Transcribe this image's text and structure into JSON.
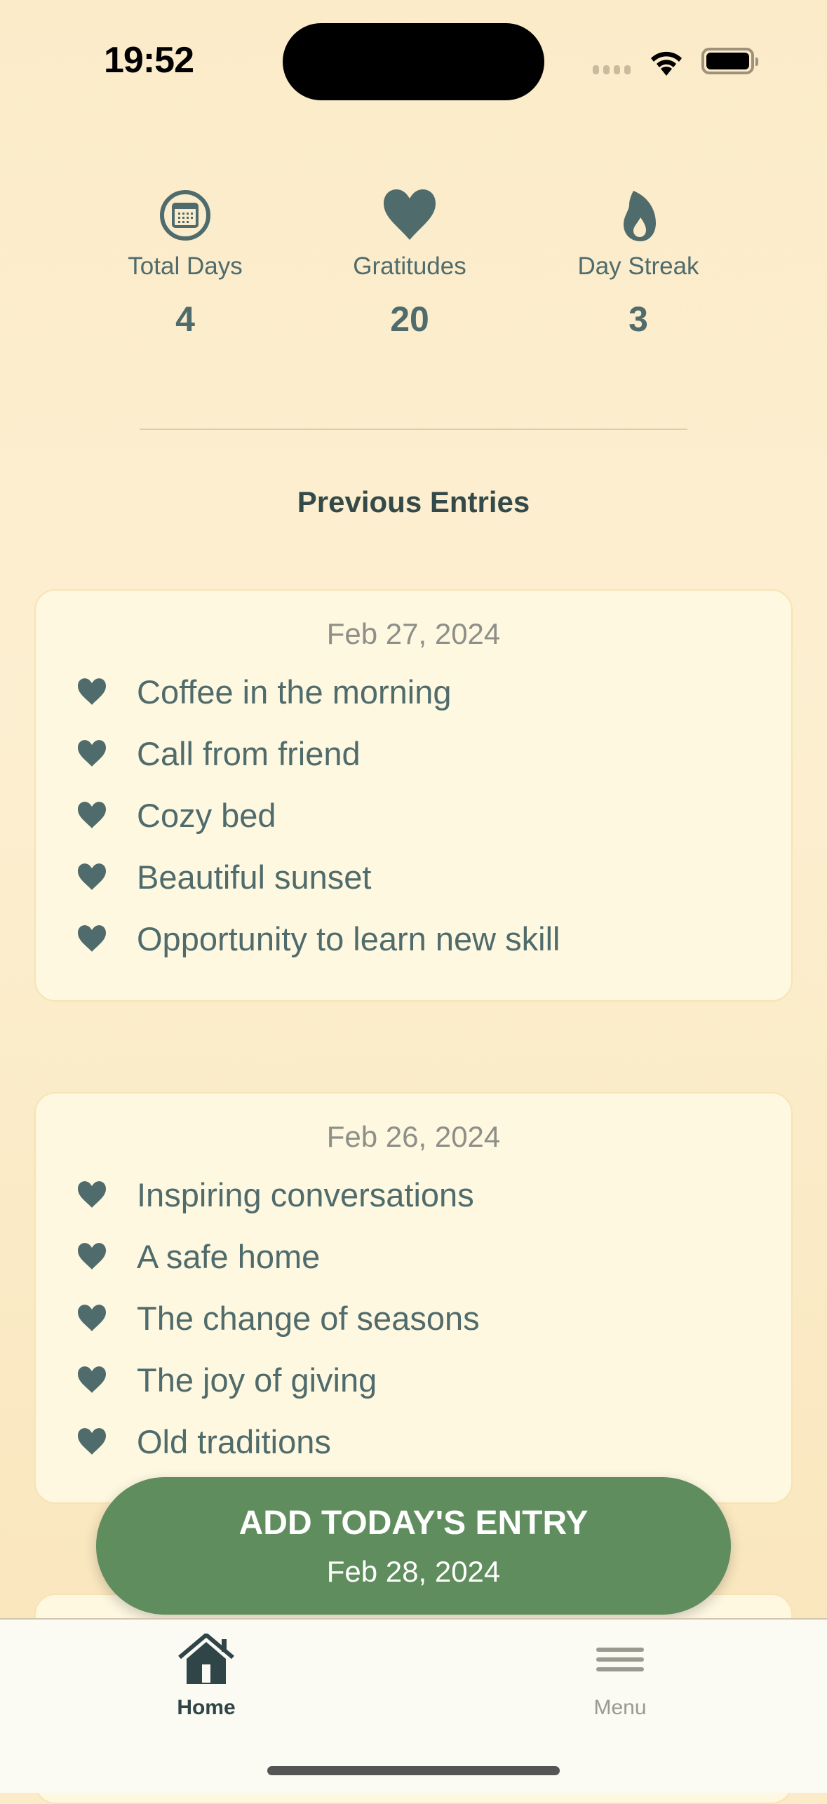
{
  "status_bar": {
    "time": "19:52"
  },
  "stats": [
    {
      "icon": "calendar-icon",
      "label": "Total Days",
      "value": "4"
    },
    {
      "icon": "heart-icon",
      "label": "Gratitudes",
      "value": "20"
    },
    {
      "icon": "flame-icon",
      "label": "Day Streak",
      "value": "3"
    }
  ],
  "section_title": "Previous Entries",
  "entries": [
    {
      "date": "Feb 27, 2024",
      "items": [
        "Coffee in the morning",
        "Call from friend",
        "Cozy bed",
        "Beautiful sunset",
        "Opportunity to learn new skill"
      ]
    },
    {
      "date": "Feb 26, 2024",
      "items": [
        "Inspiring conversations",
        "A safe home",
        "The change of seasons",
        "The joy of giving",
        "Old traditions"
      ]
    }
  ],
  "add_button": {
    "label": "ADD TODAY'S ENTRY",
    "date": "Feb 28, 2024"
  },
  "tabs": [
    {
      "label": "Home",
      "active": true
    },
    {
      "label": "Menu",
      "active": false
    }
  ],
  "colors": {
    "primary": "#4f6b6b",
    "button": "#5f8d5d",
    "background": "#fbebc9",
    "card": "#fef8e1"
  }
}
